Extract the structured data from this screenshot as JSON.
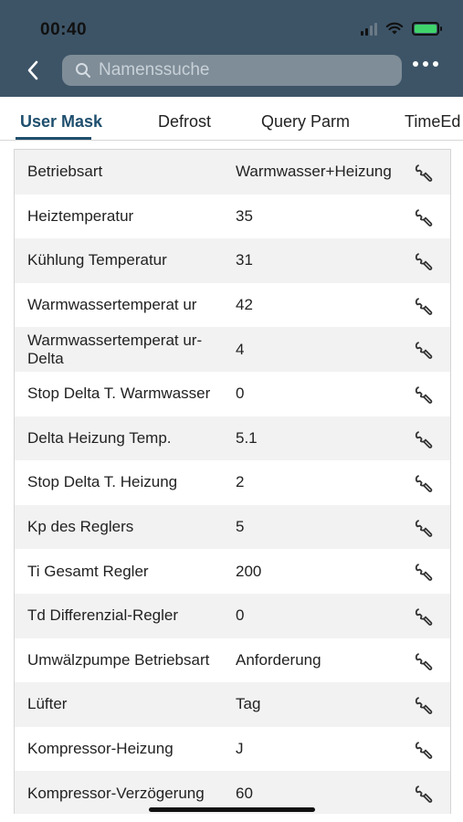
{
  "status_bar": {
    "time": "00:40"
  },
  "search": {
    "placeholder": "Namenssuche"
  },
  "tabs": [
    {
      "label": "User Mask",
      "active": true
    },
    {
      "label": "Defrost",
      "active": false
    },
    {
      "label": "Query Parm",
      "active": false
    },
    {
      "label": "TimeEd",
      "active": false
    }
  ],
  "rows": [
    {
      "label": "Betriebsart",
      "value": "Warmwasser+Heizung"
    },
    {
      "label": "Heiztemperatur",
      "value": "35"
    },
    {
      "label": "Kühlung Temperatur",
      "value": "31"
    },
    {
      "label": "Warmwassertemperat ur",
      "value": "42"
    },
    {
      "label": "Warmwassertemperat ur-Delta",
      "value": "4"
    },
    {
      "label": "Stop Delta T. Warmwasser",
      "value": "0"
    },
    {
      "label": "Delta Heizung Temp.",
      "value": "5.1"
    },
    {
      "label": "Stop Delta T. Heizung",
      "value": "2"
    },
    {
      "label": "Kp des Reglers",
      "value": "5"
    },
    {
      "label": "Ti Gesamt Regler",
      "value": "200"
    },
    {
      "label": "Td Differenzial-Regler",
      "value": "0"
    },
    {
      "label": "Umwälzpumpe Betriebsart",
      "value": "Anforderung"
    },
    {
      "label": "Lüfter",
      "value": "Tag"
    },
    {
      "label": "Kompressor-Heizung",
      "value": "J"
    },
    {
      "label": "Kompressor-Verzögerung",
      "value": "60"
    }
  ],
  "colors": {
    "header": "#3d5467",
    "accent": "#1f4f6e",
    "row_alt": "#f2f2f2",
    "battery": "#3fd46b"
  },
  "icons": {
    "row_action": "wrench-icon",
    "back": "chevron-left-icon",
    "search": "search-icon",
    "more": "more-horizontal-icon"
  }
}
